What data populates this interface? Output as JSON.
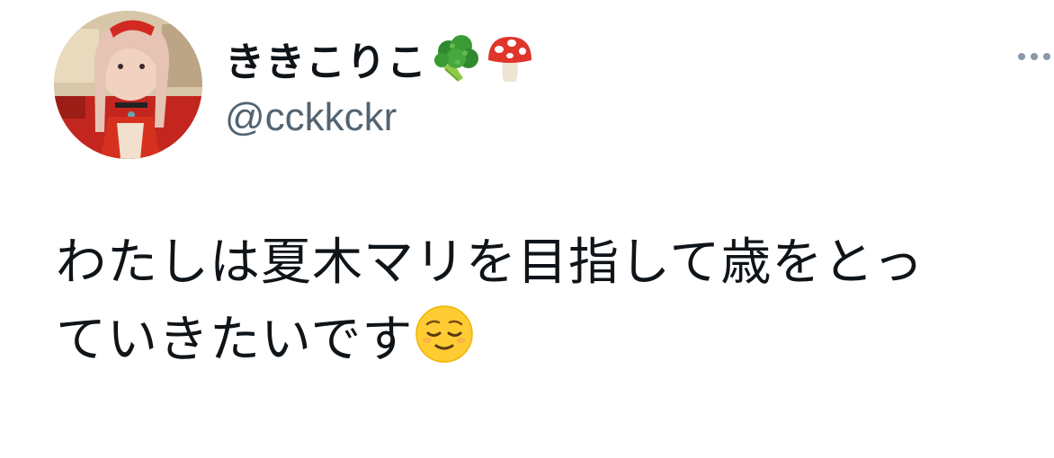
{
  "tweet": {
    "author": {
      "display_name": "ききこりこ",
      "name_emojis": [
        "broccoli-icon",
        "mushroom-icon"
      ],
      "handle": "@cckkckr"
    },
    "text_lines": [
      "わたしは夏木マリを目指して歳をとっ",
      "ていきたいです"
    ],
    "text_emoji": "relieved-face-icon"
  },
  "colors": {
    "text": "#0f1419",
    "secondary": "#536471",
    "background": "#ffffff"
  }
}
